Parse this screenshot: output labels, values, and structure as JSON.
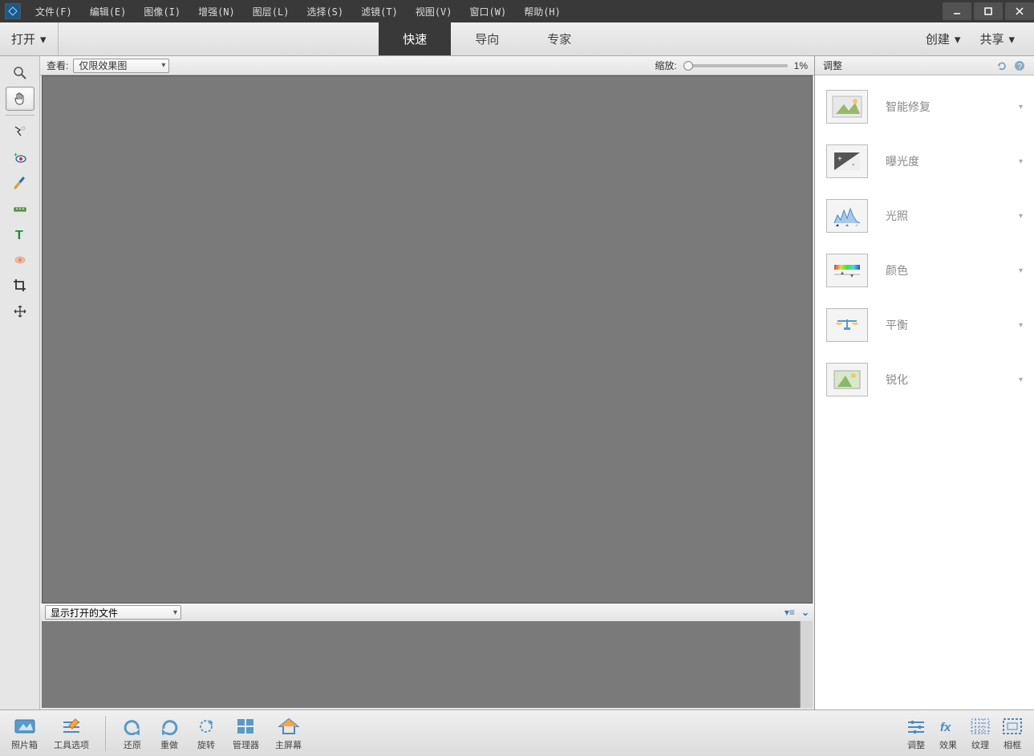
{
  "menu": {
    "items": [
      "文件(F)",
      "编辑(E)",
      "图像(I)",
      "增强(N)",
      "图层(L)",
      "选择(S)",
      "滤镜(T)",
      "视图(V)",
      "窗口(W)",
      "帮助(H)"
    ]
  },
  "modebar": {
    "open": "打开",
    "tabs": [
      "快速",
      "导向",
      "专家"
    ],
    "active_tab": 0,
    "create": "创建",
    "share": "共享"
  },
  "optbar": {
    "view_label": "查看:",
    "view_value": "仅限效果图",
    "zoom_label": "缩放:",
    "zoom_value": "1%"
  },
  "photobin": {
    "show_files": "显示打开的文件"
  },
  "rpanel": {
    "title": "调整",
    "items": [
      {
        "label": "智能修复",
        "icon": "photo"
      },
      {
        "label": "曝光度",
        "icon": "exposure"
      },
      {
        "label": "光照",
        "icon": "levels"
      },
      {
        "label": "颜色",
        "icon": "color"
      },
      {
        "label": "平衡",
        "icon": "balance"
      },
      {
        "label": "锐化",
        "icon": "sharpen"
      }
    ]
  },
  "tools": [
    {
      "name": "zoom-tool",
      "active": false
    },
    {
      "name": "hand-tool",
      "active": true
    },
    {
      "sep": true
    },
    {
      "name": "quick-select-tool",
      "active": false
    },
    {
      "name": "redeye-tool",
      "active": false
    },
    {
      "name": "whiten-teeth-tool",
      "active": false
    },
    {
      "name": "straighten-tool",
      "active": false
    },
    {
      "name": "type-tool",
      "active": false
    },
    {
      "name": "spot-heal-tool",
      "active": false
    },
    {
      "name": "crop-tool",
      "active": false
    },
    {
      "name": "move-tool",
      "active": false
    }
  ],
  "bottombar": {
    "left": [
      {
        "label": "照片箱",
        "icon": "photo-bin"
      },
      {
        "label": "工具选项",
        "icon": "tool-options"
      },
      {
        "label": "还原",
        "icon": "undo",
        "sep": true
      },
      {
        "label": "重做",
        "icon": "redo"
      },
      {
        "label": "旋转",
        "icon": "rotate"
      },
      {
        "label": "管理器",
        "icon": "organizer"
      },
      {
        "label": "主屏幕",
        "icon": "home"
      }
    ],
    "right": [
      {
        "label": "调整",
        "icon": "adjust"
      },
      {
        "label": "效果",
        "icon": "fx"
      },
      {
        "label": "纹理",
        "icon": "texture"
      },
      {
        "label": "相框",
        "icon": "frame"
      }
    ]
  }
}
